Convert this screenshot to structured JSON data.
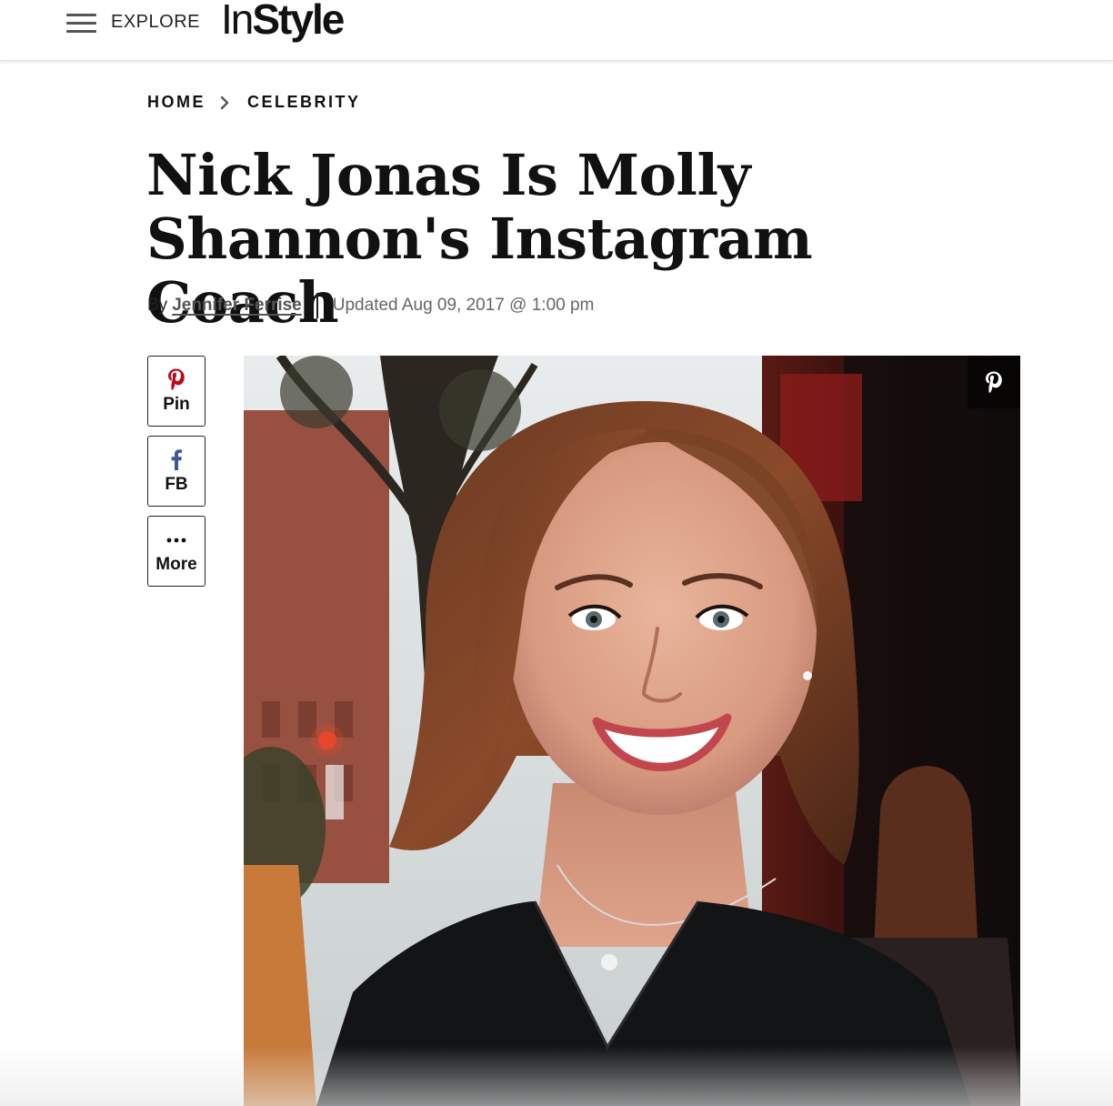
{
  "nav": {
    "explore_label": "EXPLORE",
    "logo_part1": "In",
    "logo_part2": "Style"
  },
  "breadcrumb": {
    "items": [
      {
        "label": "HOME"
      },
      {
        "label": "CELEBRITY"
      }
    ]
  },
  "article": {
    "headline": "Nick Jonas Is Molly Shannon's Instagram Coach",
    "byline_prefix": "By",
    "author": "Jennifer Ferrise",
    "updated": "Updated Aug 09, 2017 @ 1:00 pm"
  },
  "share": {
    "pin_label": "Pin",
    "fb_label": "FB",
    "more_label": "More"
  },
  "colors": {
    "pinterest": "#bd081c",
    "facebook": "#3b5998",
    "text": "#111111",
    "muted": "#666666"
  },
  "icons": {
    "menu": "hamburger-icon",
    "breadcrumb_sep": "chevron-right-icon",
    "pin": "pinterest-icon",
    "fb": "facebook-icon",
    "more": "ellipsis-icon",
    "image_pin": "pinterest-icon"
  }
}
